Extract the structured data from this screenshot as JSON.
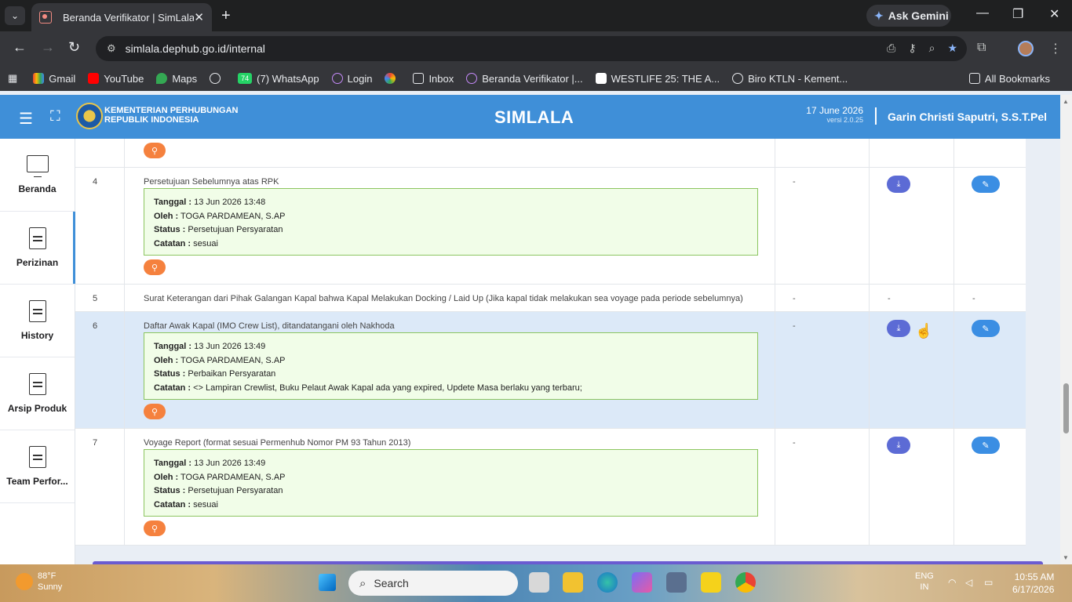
{
  "browser": {
    "tab_title": "Beranda Verifikator | SimLala",
    "tab_close": "✕",
    "new_tab": "+",
    "gemini_label": "Ask Gemini",
    "url": "simlala.dephub.go.id/internal",
    "bookmarks": [
      "Gmail",
      "YouTube",
      "Maps",
      "",
      "(7) WhatsApp",
      "Login",
      "",
      "Inbox",
      "Beranda Verifikator |...",
      "WESTLIFE 25: THE A...",
      "Biro KTLN - Kement..."
    ],
    "all_bookmarks": "All Bookmarks",
    "whatsapp_badge": "74"
  },
  "header": {
    "ministry_line1": "KEMENTERIAN PERHUBUNGAN",
    "ministry_line2": "REPUBLIK INDONESIA",
    "brand": "SIMLALA",
    "date": "17 June 2026",
    "version": "versi 2.0.25",
    "user": "Garin Christi Saputri, S.S.T.Pel"
  },
  "sidebar": {
    "items": [
      {
        "label": "Beranda",
        "icon": "monitor-icon"
      },
      {
        "label": "Perizinan",
        "icon": "document-icon"
      },
      {
        "label": "History",
        "icon": "document-icon"
      },
      {
        "label": "Arsip Produk",
        "icon": "document-icon"
      },
      {
        "label": "Team Perfor...",
        "icon": "document-icon"
      }
    ]
  },
  "rows": [
    {
      "no": "4",
      "title": "Persetujuan Sebelumnya atas RPK",
      "tanggal": "13 Jun 2026 13:48",
      "oleh": "TOGA PARDAMEAN, S.AP",
      "status": "Persetujuan Persyaratan",
      "catatan": "sesuai",
      "col3": "-"
    },
    {
      "no": "5",
      "title": "Surat Keterangan dari Pihak Galangan Kapal bahwa Kapal Melakukan Docking / Laid Up (Jika kapal tidak melakukan sea voyage pada periode sebelumnya)",
      "col3": "-",
      "col4": "-",
      "col5": "-"
    },
    {
      "no": "6",
      "title": "Daftar Awak Kapal (IMO Crew List), ditandatangani oleh Nakhoda",
      "tanggal": "13 Jun 2026 13:49",
      "oleh": "TOGA PARDAMEAN, S.AP",
      "status": "Perbaikan Persyaratan",
      "catatan": "<> Lampiran Crewlist, Buku Pelaut Awak Kapal ada yang expired, Updete Masa berlaku yang terbaru;",
      "col3": "-"
    },
    {
      "no": "7",
      "title": "Voyage Report (format sesuai Permenhub Nomor PM 93 Tahun 2013)",
      "tanggal": "13 Jun 2026 13:49",
      "oleh": "TOGA PARDAMEAN, S.AP",
      "status": "Persetujuan Persyaratan",
      "catatan": "sesuai",
      "col3": "-"
    }
  ],
  "labels": {
    "tanggal": "Tanggal :",
    "oleh": "Oleh :",
    "status": "Status :",
    "catatan": "Catatan :"
  },
  "taskbar": {
    "temp": "88°F",
    "weather": "Sunny",
    "search": "Search",
    "lang1": "ENG",
    "lang2": "IN",
    "time": "10:55 AM",
    "date": "6/17/2026"
  }
}
